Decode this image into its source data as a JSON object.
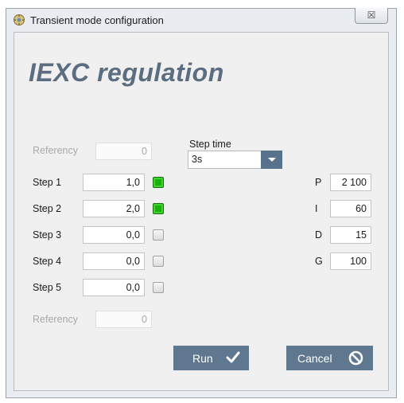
{
  "window": {
    "title": "Transient mode configuration",
    "close_glyph": "☒"
  },
  "heading": "IEXC regulation",
  "referency_top": {
    "label": "Referency",
    "value": "0"
  },
  "referency_bottom": {
    "label": "Referency",
    "value": "0"
  },
  "step_time": {
    "label": "Step time",
    "value": "3s"
  },
  "steps": [
    {
      "label": "Step 1",
      "value": "1,0",
      "checked": true
    },
    {
      "label": "Step 2",
      "value": "2,0",
      "checked": true
    },
    {
      "label": "Step 3",
      "value": "0,0",
      "checked": false
    },
    {
      "label": "Step 4",
      "value": "0,0",
      "checked": false
    },
    {
      "label": "Step 5",
      "value": "0,0",
      "checked": false
    }
  ],
  "params": [
    {
      "label": "P",
      "value": "2 100"
    },
    {
      "label": "I",
      "value": "60"
    },
    {
      "label": "D",
      "value": "15"
    },
    {
      "label": "G",
      "value": "100"
    }
  ],
  "buttons": {
    "run": "Run",
    "cancel": "Cancel"
  },
  "colors": {
    "accent": "#60788f",
    "heading": "#5b6d80",
    "checked": "#19b10a"
  }
}
